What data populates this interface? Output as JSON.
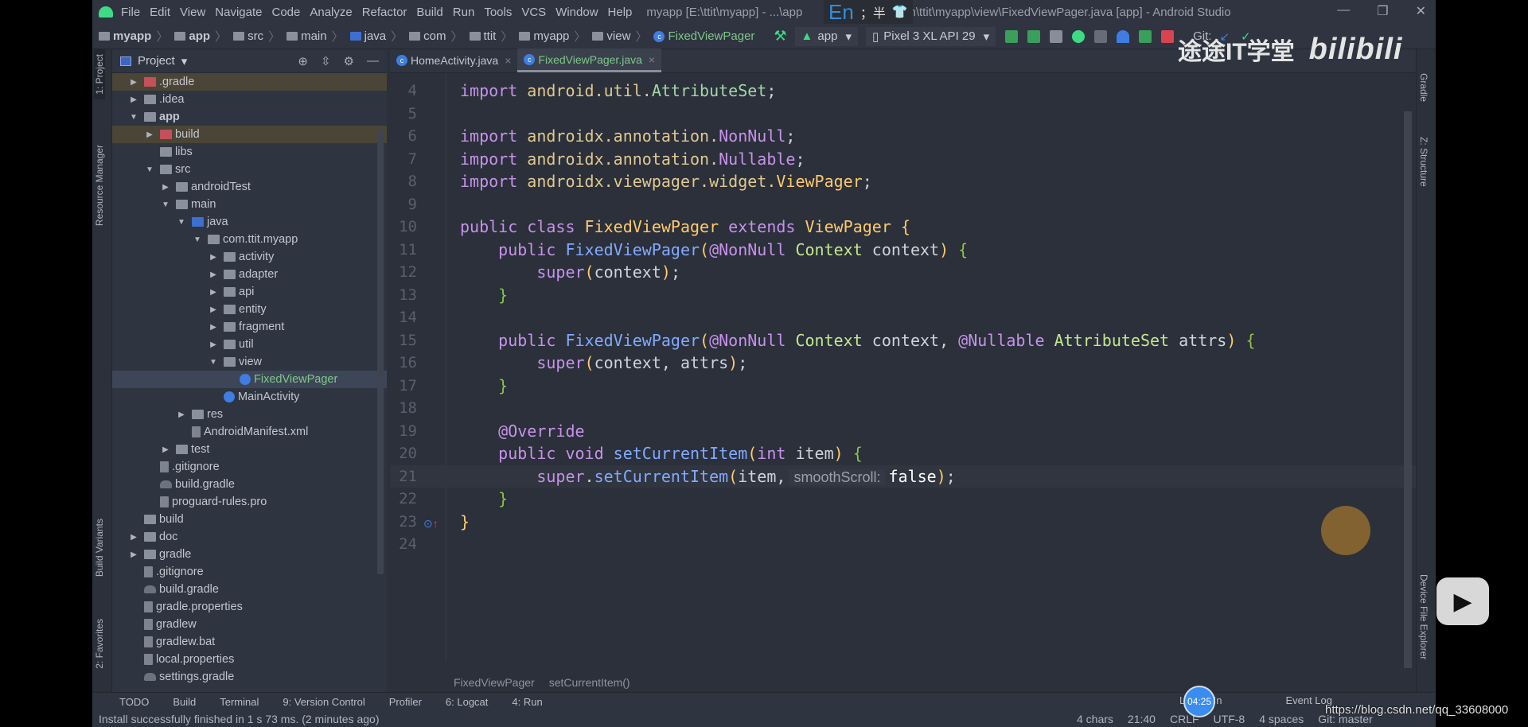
{
  "menu": {
    "items": [
      "File",
      "Edit",
      "View",
      "Navigate",
      "Code",
      "Analyze",
      "Refactor",
      "Build",
      "Run",
      "Tools",
      "VCS",
      "Window",
      "Help"
    ],
    "title": "myapp [E:\\ttit\\myapp] - ...\\app",
    "title_rest": "m\\ttit\\myapp\\view\\FixedViewPager.java [app] - Android Studio",
    "window_buttons": [
      "—",
      "❐",
      "✕"
    ]
  },
  "nav": {
    "crumbs": [
      "myapp",
      "app",
      "src",
      "main",
      "java",
      "com",
      "ttit",
      "myapp",
      "view",
      "FixedViewPager"
    ],
    "run_config": "app",
    "device": "Pixel 3 XL API 29",
    "git_label": "Git:"
  },
  "left_tabs": [
    "1: Project",
    "Resource Manager",
    "Build Variants",
    "2: Favorites"
  ],
  "right_tabs": [
    "Gradle",
    "Z: Structure",
    "Device File Explorer"
  ],
  "project": {
    "title": "Project",
    "tree": [
      {
        "label": ".gradle",
        "depth": 0,
        "arrow": "right",
        "icon": "red",
        "row": "hl"
      },
      {
        "label": ".idea",
        "depth": 0,
        "arrow": "right",
        "icon": "folder"
      },
      {
        "label": "app",
        "depth": 0,
        "arrow": "down",
        "icon": "folder",
        "style": "bold"
      },
      {
        "label": "build",
        "depth": 1,
        "arrow": "right",
        "icon": "red",
        "row": "hl"
      },
      {
        "label": "libs",
        "depth": 1,
        "arrow": "",
        "icon": "folder"
      },
      {
        "label": "src",
        "depth": 1,
        "arrow": "down",
        "icon": "folder"
      },
      {
        "label": "androidTest",
        "depth": 2,
        "arrow": "right",
        "icon": "folder"
      },
      {
        "label": "main",
        "depth": 2,
        "arrow": "down",
        "icon": "folder"
      },
      {
        "label": "java",
        "depth": 3,
        "arrow": "down",
        "icon": "blue"
      },
      {
        "label": "com.ttit.myapp",
        "depth": 4,
        "arrow": "down",
        "icon": "folder"
      },
      {
        "label": "activity",
        "depth": 5,
        "arrow": "right",
        "icon": "folder"
      },
      {
        "label": "adapter",
        "depth": 5,
        "arrow": "right",
        "icon": "folder"
      },
      {
        "label": "api",
        "depth": 5,
        "arrow": "right",
        "icon": "folder"
      },
      {
        "label": "entity",
        "depth": 5,
        "arrow": "right",
        "icon": "folder"
      },
      {
        "label": "fragment",
        "depth": 5,
        "arrow": "right",
        "icon": "folder"
      },
      {
        "label": "util",
        "depth": 5,
        "arrow": "right",
        "icon": "folder"
      },
      {
        "label": "view",
        "depth": 5,
        "arrow": "down",
        "icon": "folder"
      },
      {
        "label": "FixedViewPager",
        "depth": 6,
        "arrow": "",
        "icon": "cls",
        "row": "sel",
        "style": "green"
      },
      {
        "label": "MainActivity",
        "depth": 5,
        "arrow": "",
        "icon": "cls"
      },
      {
        "label": "res",
        "depth": 3,
        "arrow": "right",
        "icon": "folder"
      },
      {
        "label": "AndroidManifest.xml",
        "depth": 3,
        "arrow": "",
        "icon": "file"
      },
      {
        "label": "test",
        "depth": 2,
        "arrow": "right",
        "icon": "folder"
      },
      {
        "label": ".gitignore",
        "depth": 1,
        "arrow": "",
        "icon": "file"
      },
      {
        "label": "build.gradle",
        "depth": 1,
        "arrow": "",
        "icon": "gradle"
      },
      {
        "label": "proguard-rules.pro",
        "depth": 1,
        "arrow": "",
        "icon": "file"
      },
      {
        "label": "build",
        "depth": 0,
        "arrow": "",
        "icon": "folder"
      },
      {
        "label": "doc",
        "depth": 0,
        "arrow": "right",
        "icon": "folder"
      },
      {
        "label": "gradle",
        "depth": 0,
        "arrow": "right",
        "icon": "folder"
      },
      {
        "label": ".gitignore",
        "depth": 0,
        "arrow": "",
        "icon": "file"
      },
      {
        "label": "build.gradle",
        "depth": 0,
        "arrow": "",
        "icon": "gradle"
      },
      {
        "label": "gradle.properties",
        "depth": 0,
        "arrow": "",
        "icon": "file"
      },
      {
        "label": "gradlew",
        "depth": 0,
        "arrow": "",
        "icon": "file"
      },
      {
        "label": "gradlew.bat",
        "depth": 0,
        "arrow": "",
        "icon": "file"
      },
      {
        "label": "local.properties",
        "depth": 0,
        "arrow": "",
        "icon": "file"
      },
      {
        "label": "settings.gradle",
        "depth": 0,
        "arrow": "",
        "icon": "gradle"
      }
    ]
  },
  "tabs": [
    {
      "label": "HomeActivity.java",
      "active": false
    },
    {
      "label": "FixedViewPager.java",
      "active": true
    }
  ],
  "code": [
    {
      "n": "4",
      "t": [
        [
          "kw",
          "import "
        ],
        [
          "pkg",
          "android.util."
        ],
        [
          "cls",
          "AttributeSet"
        ],
        [
          "plain",
          ";"
        ]
      ]
    },
    {
      "n": "5",
      "t": []
    },
    {
      "n": "6",
      "t": [
        [
          "kw",
          "import "
        ],
        [
          "pkg",
          "androidx.annotation."
        ],
        [
          "kw",
          "NonNull"
        ],
        [
          "plain",
          ";"
        ]
      ]
    },
    {
      "n": "7",
      "t": [
        [
          "kw",
          "import "
        ],
        [
          "pkg",
          "androidx.annotation."
        ],
        [
          "kw",
          "Nullable"
        ],
        [
          "plain",
          ";"
        ]
      ]
    },
    {
      "n": "8",
      "t": [
        [
          "kw",
          "import "
        ],
        [
          "pkg",
          "androidx.viewpager.widget."
        ],
        [
          "decl",
          "ViewPager"
        ],
        [
          "plain",
          ";"
        ]
      ]
    },
    {
      "n": "9",
      "t": []
    },
    {
      "n": "10",
      "t": [
        [
          "kw",
          "public class "
        ],
        [
          "decl",
          "FixedViewPager "
        ],
        [
          "kw",
          "extends "
        ],
        [
          "decl",
          "ViewPager "
        ],
        [
          "by",
          "{"
        ]
      ]
    },
    {
      "n": "11",
      "t": [
        [
          "plain",
          "    "
        ],
        [
          "kw",
          "public "
        ],
        [
          "fn",
          "FixedViewPager"
        ],
        [
          "paren",
          "("
        ],
        [
          "ann",
          "@NonNull "
        ],
        [
          "type",
          "Context "
        ],
        [
          "plain",
          "context"
        ],
        [
          "paren",
          ")"
        ],
        [
          "bg",
          " {"
        ]
      ]
    },
    {
      "n": "12",
      "t": [
        [
          "plain",
          "        "
        ],
        [
          "kw",
          "super"
        ],
        [
          "paren",
          "("
        ],
        [
          "plain",
          "context"
        ],
        [
          "paren",
          ")"
        ],
        [
          "plain",
          ";"
        ]
      ]
    },
    {
      "n": "13",
      "t": [
        [
          "plain",
          "    "
        ],
        [
          "bg",
          "}"
        ]
      ]
    },
    {
      "n": "14",
      "t": []
    },
    {
      "n": "15",
      "t": [
        [
          "plain",
          "    "
        ],
        [
          "kw",
          "public "
        ],
        [
          "fn",
          "FixedViewPager"
        ],
        [
          "paren",
          "("
        ],
        [
          "ann",
          "@NonNull "
        ],
        [
          "type",
          "Context "
        ],
        [
          "plain",
          "context, "
        ],
        [
          "ann",
          "@Nullable "
        ],
        [
          "type",
          "AttributeSet "
        ],
        [
          "plain",
          "attrs"
        ],
        [
          "paren",
          ")"
        ],
        [
          "bg",
          " {"
        ]
      ]
    },
    {
      "n": "16",
      "t": [
        [
          "plain",
          "        "
        ],
        [
          "kw",
          "super"
        ],
        [
          "paren",
          "("
        ],
        [
          "plain",
          "context, attrs"
        ],
        [
          "paren",
          ")"
        ],
        [
          "plain",
          ";"
        ]
      ]
    },
    {
      "n": "17",
      "t": [
        [
          "plain",
          "    "
        ],
        [
          "bg",
          "}"
        ]
      ]
    },
    {
      "n": "18",
      "t": []
    },
    {
      "n": "19",
      "t": [
        [
          "plain",
          "    "
        ],
        [
          "ann",
          "@Override"
        ]
      ]
    },
    {
      "n": "20",
      "t": [
        [
          "plain",
          "    "
        ],
        [
          "kw",
          "public void "
        ],
        [
          "fn",
          "setCurrentItem"
        ],
        [
          "paren",
          "("
        ],
        [
          "kw",
          "int "
        ],
        [
          "plain",
          "item"
        ],
        [
          "paren",
          ")"
        ],
        [
          "bg",
          " {"
        ]
      ]
    },
    {
      "n": "21",
      "cur": true,
      "t": [
        [
          "plain",
          "        "
        ],
        [
          "kw",
          "super"
        ],
        [
          "plain",
          "."
        ],
        [
          "fn",
          "setCurrentItem"
        ],
        [
          "paren",
          "("
        ],
        [
          "plain",
          "item,"
        ],
        [
          "hint",
          "smoothScroll:"
        ],
        [
          "false",
          "false"
        ],
        [
          "paren",
          ")"
        ],
        [
          "plain",
          ";"
        ]
      ]
    },
    {
      "n": "22",
      "t": [
        [
          "plain",
          "    "
        ],
        [
          "bg",
          "}"
        ]
      ]
    },
    {
      "n": "23",
      "t": [
        [
          "by",
          "}"
        ]
      ]
    },
    {
      "n": "24",
      "t": []
    }
  ],
  "editor_breadcrumb": [
    "FixedViewPager",
    "setCurrentItem()"
  ],
  "tool_windows": [
    "TODO",
    "Build",
    "Terminal",
    "9: Version Control",
    "Profiler",
    "6: Logcat",
    "4: Run"
  ],
  "right_tool_windows": [
    "Layout In",
    "Event Log"
  ],
  "status": {
    "message": "Install successfully finished in 1 s 73 ms. (2 minutes ago)",
    "items": [
      "4 chars",
      "21:40",
      "CRLF",
      "UTF-8",
      "4 spaces",
      "Git: master"
    ]
  },
  "overlay": {
    "time": "04:25",
    "url": "https://blog.csdn.net/qq_33608000",
    "ime": [
      "En",
      "；半"
    ],
    "brand": "途途IT学堂",
    "bilibili": "bilibili"
  }
}
